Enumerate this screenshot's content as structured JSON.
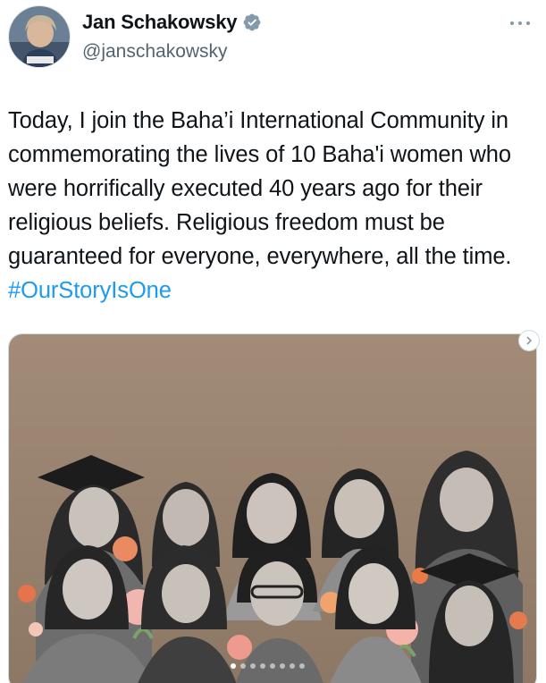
{
  "author": {
    "name": "Jan Schakowsky",
    "handle": "@janschakowsky",
    "verified": true,
    "avatar_icon": "profile-photo"
  },
  "tweet": {
    "text_before_hashtag": "Today, I join the Baha’i International Community in commemorating the lives of 10 Baha'i women who were horrifically executed 40 years ago for their religious beliefs. Religious freedom must be guaranteed for everyone, everywhere, all the time.",
    "hashtag": "#OurStoryIsOne"
  },
  "media": {
    "description_icon": "collage-photo",
    "carousel_total": 8,
    "carousel_active": 1
  },
  "colors": {
    "text": "#0f1419",
    "secondary": "#536471",
    "link": "#1d9bf0",
    "verified": "#829aab",
    "media_bg": "#a08a76"
  }
}
